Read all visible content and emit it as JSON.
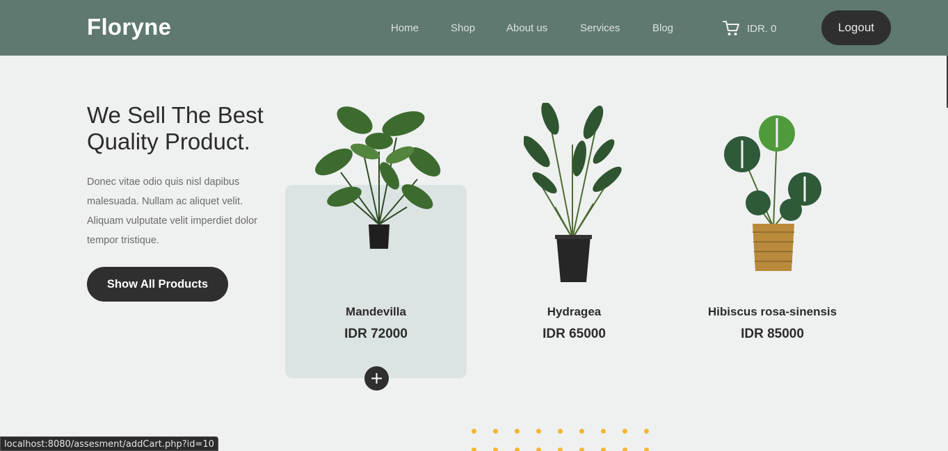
{
  "header": {
    "brand": "Floryne",
    "nav": [
      "Home",
      "Shop",
      "About us",
      "Services",
      "Blog"
    ],
    "cart_total": "IDR. 0",
    "logout_label": "Logout"
  },
  "hero": {
    "title": "We Sell The Best Quality Product.",
    "description": "Donec vitae odio quis nisl dapibus malesuada. Nullam ac aliquet velit. Aliquam vulputate velit imperdiet dolor tempor tristique.",
    "button_label": "Show All Products"
  },
  "products": [
    {
      "name": "Mandevilla",
      "price": "IDR 72000",
      "image": "plant-in-black-pot-icon"
    },
    {
      "name": "Hydragea",
      "price": "IDR 65000",
      "image": "plant-in-tall-pot-icon"
    },
    {
      "name": "Hibiscus rosa-sinensis",
      "price": "IDR 85000",
      "image": "plant-in-basket-icon"
    }
  ],
  "status_bar": "localhost:8080/assesment/addCart.php?id=10",
  "colors": {
    "header_bg": "#5f7870",
    "page_bg": "#eff1f0",
    "button_dark": "#2f2f2f",
    "card_highlight": "#dce4e3",
    "accent_dots": "#f2b632"
  }
}
